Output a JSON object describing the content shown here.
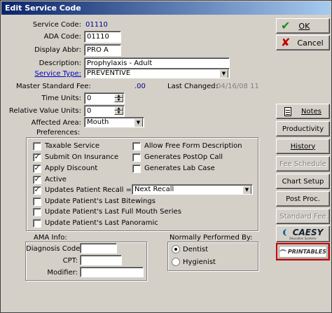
{
  "window": {
    "title": "Edit Service Code"
  },
  "form": {
    "service_code_label": "Service Code:",
    "service_code_value": "01110",
    "ada_code_label": "ADA Code:",
    "ada_code_value": "01110",
    "display_abbr_label": "Display Abbr:",
    "display_abbr_value": "PRO A",
    "description_label": "Description:",
    "description_value": "Prophylaxis - Adult",
    "service_type_label": "Service Type:",
    "service_type_value": "PREVENTIVE",
    "master_fee_label": "Master Standard Fee:",
    "master_fee_value": ".00",
    "last_changed_label": "Last Changed:",
    "last_changed_value": "04/16/08 11",
    "time_units_label": "Time Units:",
    "time_units_value": "0",
    "rvu_label": "Relative Value Units:",
    "rvu_value": "0",
    "affected_area_label": "Affected Area:",
    "affected_area_value": "Mouth",
    "preferences_label": "Preferences:"
  },
  "preferences": {
    "taxable": {
      "label": "Taxable Service",
      "checked": false
    },
    "submit_insurance": {
      "label": "Submit On Insurance",
      "checked": true
    },
    "apply_discount": {
      "label": "Apply Discount",
      "checked": true
    },
    "active": {
      "label": "Active",
      "checked": true
    },
    "updates_recall": {
      "label": "Updates Patient Recall ==>",
      "checked": true
    },
    "recall_select": "Next Recall",
    "last_bitewings": {
      "label": "Update Patient's Last Bitewings",
      "checked": false
    },
    "last_fmx": {
      "label": "Update Patient's Last Full Mouth Series",
      "checked": false
    },
    "last_pano": {
      "label": "Update Patient's Last Panoramic",
      "checked": false
    },
    "free_form": {
      "label": "Allow Free Form Description",
      "checked": false
    },
    "postop_call": {
      "label": "Generates PostOp Call",
      "checked": false
    },
    "lab_case": {
      "label": "Generates Lab Case",
      "checked": false
    }
  },
  "ama": {
    "title": "AMA Info:",
    "diagnosis_label": "Diagnosis Code:",
    "diagnosis_value": "",
    "cpt_label": "CPT:",
    "cpt_value": "",
    "modifier_label": "Modifier:",
    "modifier_value": ""
  },
  "performed_by": {
    "title": "Normally Performed By:",
    "dentist": "Dentist",
    "hygienist": "Hygienist",
    "selected": "Dentist"
  },
  "buttons": {
    "ok": "OK",
    "cancel": "Cancel",
    "notes": "Notes",
    "productivity": "Productivity",
    "history": "History",
    "fee_schedule": "Fee Schedule",
    "chart_setup": "Chart Setup",
    "post_proc": "Post Proc.",
    "standard_fee": "Standard Fee",
    "caesy": "CAESY",
    "caesy_sub": "Education Systems",
    "printables": "PRINTABLES"
  },
  "colors": {
    "title_start": "#0a246a",
    "title_end": "#a6caf0",
    "ok_check": "#1a8a1a",
    "cancel_x": "#c00000",
    "printables_border": "#cc0000"
  }
}
